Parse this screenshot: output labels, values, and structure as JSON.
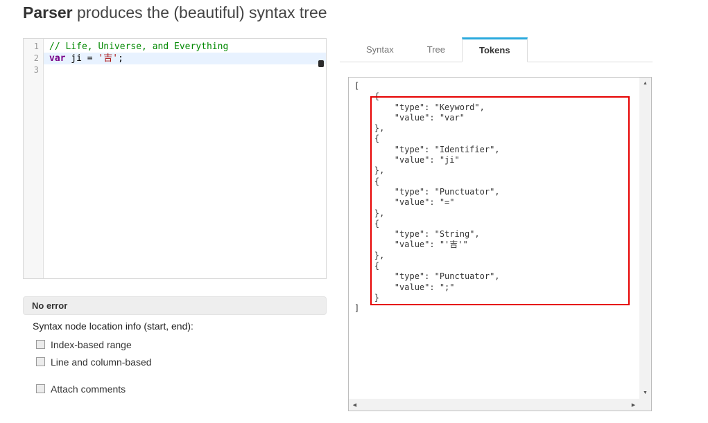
{
  "colors": {
    "accent": "#29a9dd",
    "annotation": "#e60000",
    "comment": "#008800",
    "keyword": "#770088",
    "string": "#aa1111"
  },
  "header": {
    "title_bold": "Parser",
    "title_rest": " produces the (beautiful) syntax tree"
  },
  "editor": {
    "lines": [
      {
        "number": "1",
        "active": false,
        "segments": [
          {
            "cls": "cm-comment",
            "text": "// Life, Universe, and Everything"
          }
        ]
      },
      {
        "number": "2",
        "active": true,
        "segments": [
          {
            "cls": "cm-keyword",
            "text": "var"
          },
          {
            "cls": "",
            "text": " ji = "
          },
          {
            "cls": "cm-string",
            "text": "'吉'"
          },
          {
            "cls": "",
            "text": ";"
          }
        ]
      },
      {
        "number": "3",
        "active": false,
        "segments": []
      }
    ]
  },
  "status": {
    "label": "No error"
  },
  "options": {
    "heading": "Syntax node location info (start, end):",
    "items": [
      {
        "label": "Index-based range",
        "checked": false,
        "spaced": false
      },
      {
        "label": "Line and column-based",
        "checked": false,
        "spaced": false
      },
      {
        "label": "Attach comments",
        "checked": false,
        "spaced": true
      }
    ]
  },
  "tabs": [
    {
      "label": "Syntax",
      "active": false
    },
    {
      "label": "Tree",
      "active": false
    },
    {
      "label": "Tokens",
      "active": true
    }
  ],
  "tokens_panel": {
    "lines": [
      "[",
      "    {",
      "        \"type\": \"Keyword\",",
      "        \"value\": \"var\"",
      "    },",
      "    {",
      "        \"type\": \"Identifier\",",
      "        \"value\": \"ji\"",
      "    },",
      "    {",
      "        \"type\": \"Punctuator\",",
      "        \"value\": \"=\"",
      "    },",
      "    {",
      "        \"type\": \"String\",",
      "        \"value\": \"'吉'\"",
      "    },",
      "    {",
      "        \"type\": \"Punctuator\",",
      "        \"value\": \";\"",
      "    }",
      "]"
    ]
  },
  "icons": {
    "up": "▲",
    "down": "▼",
    "left": "◀",
    "right": "▶"
  }
}
